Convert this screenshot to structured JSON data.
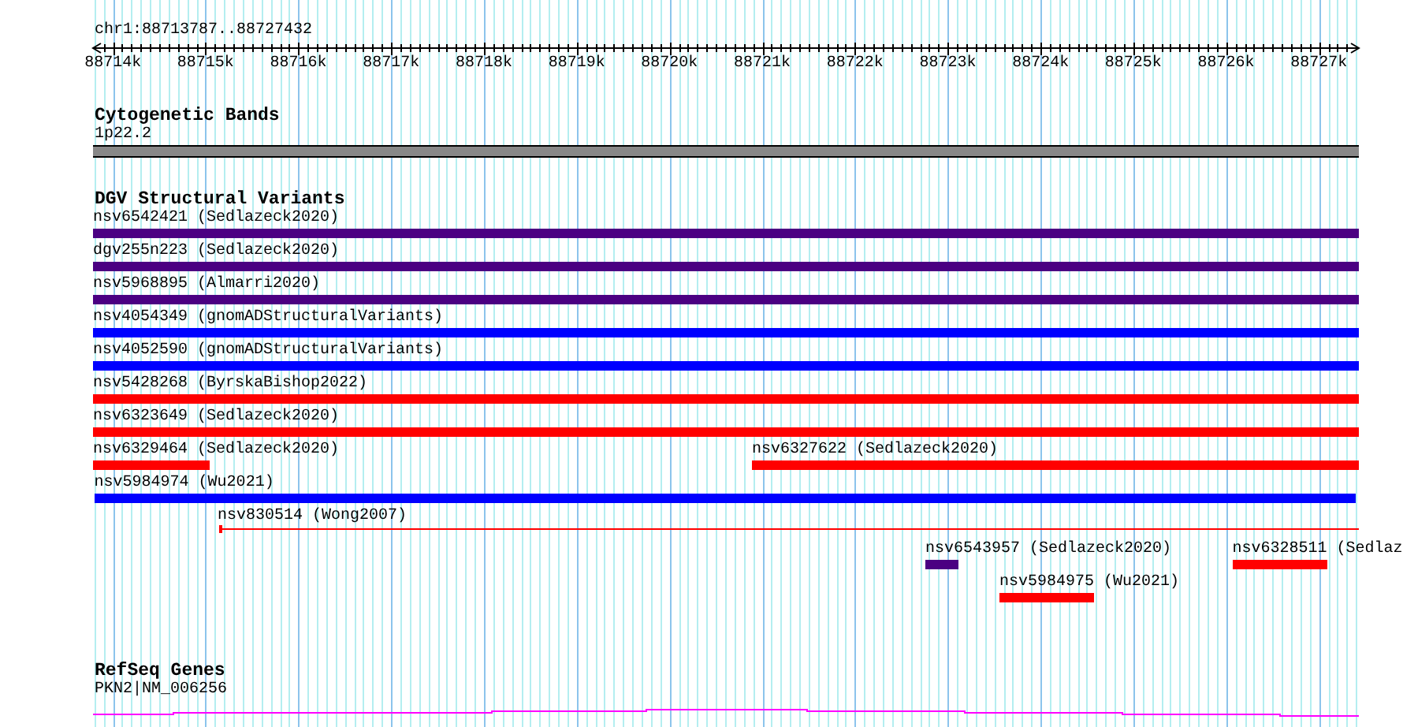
{
  "location": "chr1:88713787..88727432",
  "ruler": {
    "ticks": [
      "88714k",
      "88715k",
      "88716k",
      "88717k",
      "88718k",
      "88719k",
      "88720k",
      "88721k",
      "88722k",
      "88723k",
      "88724k",
      "88725k",
      "88726k",
      "88727k"
    ]
  },
  "tracks": [
    {
      "kind": "bands",
      "title": "Cytogenetic Bands",
      "features": [
        {
          "label": "1p22.2"
        }
      ]
    },
    {
      "kind": "variants",
      "title": "DGV Structural Variants",
      "features": [
        {
          "kind": "bar",
          "label": "nsv6542421 (Sedlazeck2020)",
          "color": "#4b0082"
        },
        {
          "kind": "bar",
          "label": "dgv255n223 (Sedlazeck2020)",
          "color": "#4b0082"
        },
        {
          "kind": "bar",
          "label": "nsv5968895 (Almarri2020)",
          "color": "#4b0082"
        },
        {
          "kind": "bar",
          "label": "nsv4054349 (gnomADStructuralVariants)",
          "color": "#0000ff"
        },
        {
          "kind": "bar",
          "label": "nsv4052590 (gnomADStructuralVariants)",
          "color": "#0000ff"
        },
        {
          "kind": "bar",
          "label": "nsv5428268 (ByrskaBishop2022)",
          "color": "#ff0000"
        },
        {
          "kind": "bar",
          "label": "nsv6323649 (Sedlazeck2020)",
          "color": "#ff0000"
        },
        {
          "kind": "bar",
          "label": "nsv6329464 (Sedlazeck2020)",
          "color": "#ff0000"
        },
        {
          "kind": "bar",
          "label": "nsv6327622 (Sedlazeck2020)",
          "color": "#ff0000"
        },
        {
          "kind": "bar",
          "label": "nsv5984974 (Wu2021)",
          "color": "#0000ff"
        },
        {
          "kind": "line",
          "label": "nsv830514 (Wong2007)",
          "color": "#ff0000"
        },
        {
          "kind": "bar",
          "label": "nsv6543957 (Sedlazeck2020)",
          "color": "#4b0082"
        },
        {
          "kind": "bar",
          "label": "nsv6328511 (Sedlaz",
          "color": "#ff0000"
        },
        {
          "kind": "bar",
          "label": "nsv5984975 (Wu2021)",
          "color": "#ff0000"
        }
      ]
    },
    {
      "kind": "genes",
      "title": "RefSeq Genes",
      "features": [
        {
          "label": "PKN2|NM_006256"
        }
      ]
    }
  ]
}
